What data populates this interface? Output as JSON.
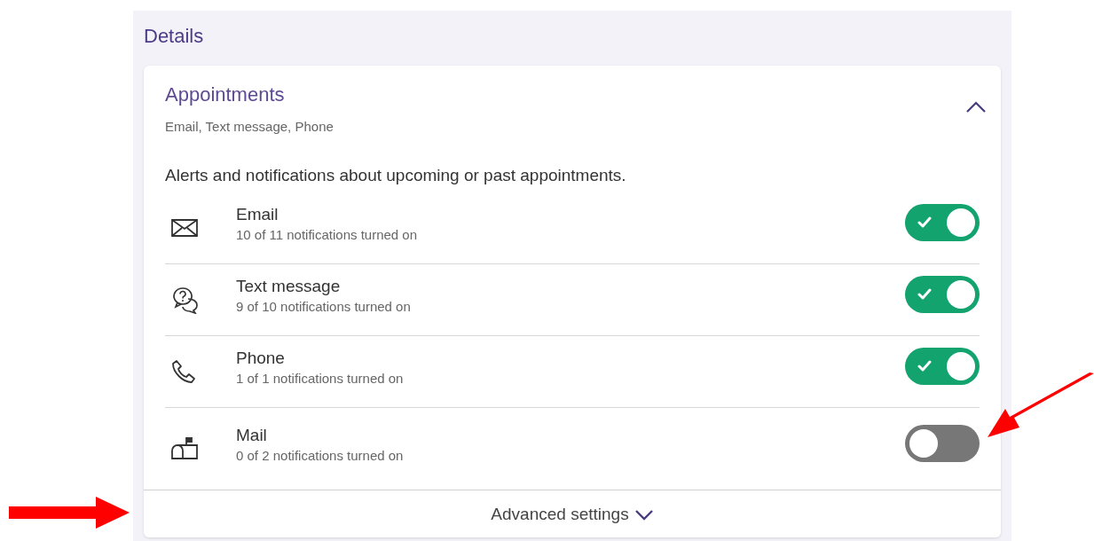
{
  "heading": "Details",
  "section": {
    "title": "Appointments",
    "summary": "Email, Text message, Phone",
    "expanded": true,
    "description": "Alerts and notifications about upcoming or past appointments.",
    "channels": [
      {
        "kind": "email",
        "name": "Email",
        "status": "10 of 11 notifications turned on",
        "on": true
      },
      {
        "kind": "text",
        "name": "Text message",
        "status": "9 of 10 notifications turned on",
        "on": true
      },
      {
        "kind": "phone",
        "name": "Phone",
        "status": "1 of 1 notifications turned on",
        "on": true
      },
      {
        "kind": "mail",
        "name": "Mail",
        "status": "0 of 2 notifications turned on",
        "on": false
      }
    ]
  },
  "advanced": {
    "label": "Advanced settings",
    "expanded": false
  }
}
